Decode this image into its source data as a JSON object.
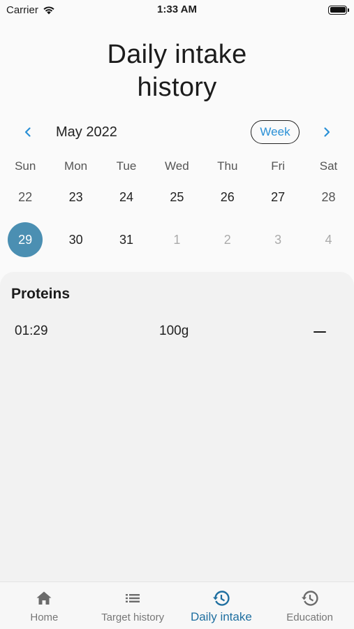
{
  "status_bar": {
    "carrier": "Carrier",
    "time": "1:33 AM"
  },
  "page": {
    "title_line1": "Daily intake",
    "title_line2": "history"
  },
  "calendar": {
    "month_label": "May 2022",
    "format_button": "Week",
    "days_of_week": [
      "Sun",
      "Mon",
      "Tue",
      "Wed",
      "Thu",
      "Fri",
      "Sat"
    ],
    "week1": [
      "22",
      "23",
      "24",
      "25",
      "26",
      "27",
      "28"
    ],
    "week2": [
      "29",
      "30",
      "31",
      "1",
      "2",
      "3",
      "4"
    ],
    "selected_day": "29"
  },
  "events": {
    "section_title": "Proteins",
    "items": [
      {
        "time": "01:29",
        "amount": "100g"
      }
    ]
  },
  "bottom_nav": {
    "items": [
      {
        "label": "Home",
        "icon": "home-icon"
      },
      {
        "label": "Target history",
        "icon": "list-icon"
      },
      {
        "label": "Daily intake",
        "icon": "history-icon",
        "active": true
      },
      {
        "label": "Education",
        "icon": "history-icon"
      }
    ]
  },
  "colors": {
    "accent": "#4b8fb2",
    "link": "#2a90d6",
    "nav_active": "#1f6fa0"
  }
}
